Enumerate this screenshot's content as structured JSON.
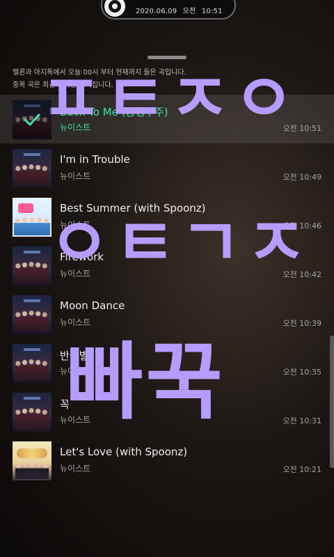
{
  "status_pill": {
    "date": "2020.06.09",
    "ampm": "오전",
    "time": "10:51"
  },
  "notice": {
    "line1": "멜론과 아지톡에서 오늘 00시 부터 현재까지 들은 곡입니다.",
    "line2": "중복 곡은 최근 기록만 보여집니다."
  },
  "tracks": [
    {
      "title": "Back To Me (궁행우주)",
      "artist": "뉴이스트",
      "time": "오전 10:51",
      "cover": "dark",
      "current": true
    },
    {
      "title": "I'm in Trouble",
      "artist": "뉴이스트",
      "time": "오전 10:49",
      "cover": "dark"
    },
    {
      "title": "Best Summer (with Spoonz)",
      "artist": "뉴이스트",
      "time": "오전 10:46",
      "cover": "bright"
    },
    {
      "title": "Firework",
      "artist": "뉴이스트",
      "time": "오전 10:42",
      "cover": "dark"
    },
    {
      "title": "Moon Dance",
      "artist": "뉴이스트",
      "time": "오전 10:39",
      "cover": "dark"
    },
    {
      "title": "반짝별",
      "artist": "뉴이스트",
      "time": "오전 10:35",
      "cover": "dark"
    },
    {
      "title": "꼭",
      "artist": "뉴이스트",
      "time": "오전 10:31",
      "cover": "dark"
    },
    {
      "title": "Let's Love (with Spoonz)",
      "artist": "뉴이스트",
      "time": "오전 10:21",
      "cover": "gold"
    }
  ],
  "handwriting": {
    "line1": "ㅍㅌㅈㅇ",
    "line2": "ㅇㅌㄱㅈ",
    "line3": "빠꾹",
    "color": "#b69cff"
  }
}
